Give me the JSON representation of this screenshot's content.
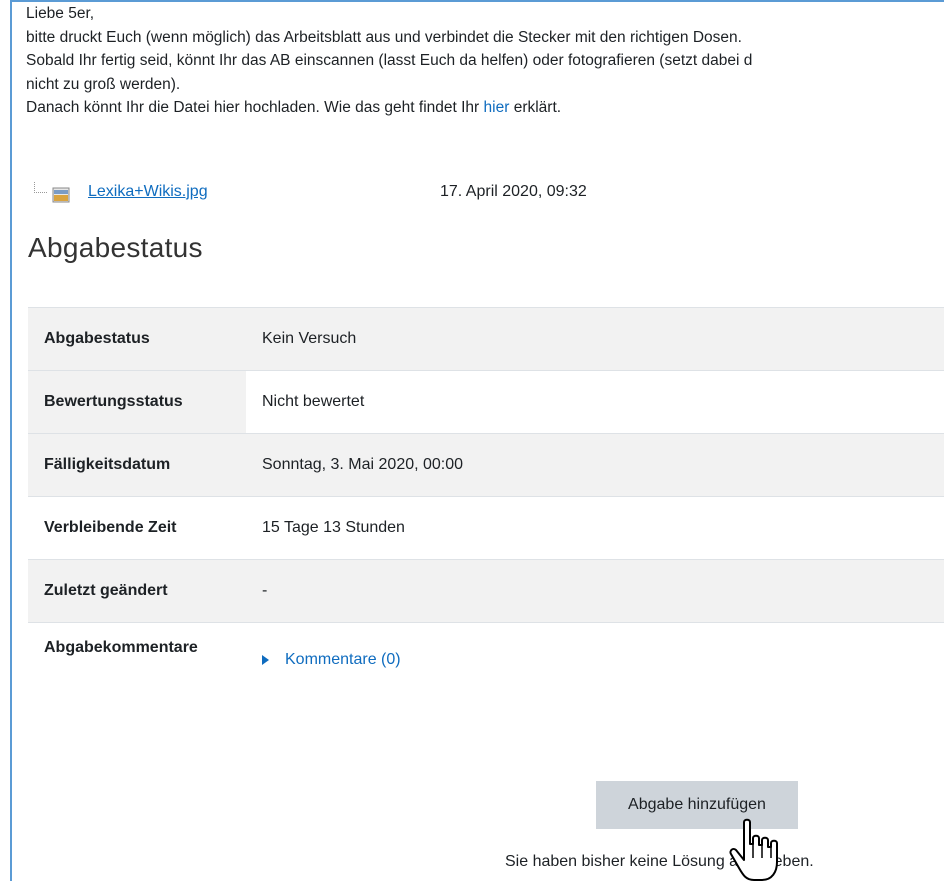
{
  "intro": {
    "line1": "Liebe 5er,",
    "line2": "bitte druckt Euch (wenn möglich) das Arbeitsblatt aus und verbindet die Stecker mit den richtigen Dosen.",
    "line3": "Sobald Ihr fertig seid, könnt Ihr das AB einscannen (lasst Euch da helfen) oder fotografieren (setzt dabei d",
    "line4": "nicht zu groß werden).",
    "line5_before": "Danach könnt Ihr die Datei hier hochladen. Wie das geht findet Ihr ",
    "line5_link": "hier",
    "line5_after": " erklärt."
  },
  "attachment": {
    "icon": "image-file-icon",
    "name": "Lexika+Wikis.jpg",
    "date": "17. April 2020, 09:32"
  },
  "section_title": "Abgabestatus",
  "status_rows": [
    {
      "label": "Abgabestatus",
      "value": "Kein Versuch"
    },
    {
      "label": "Bewertungsstatus",
      "value": "Nicht bewertet"
    },
    {
      "label": "Fälligkeitsdatum",
      "value": "Sonntag, 3. Mai 2020, 00:00"
    },
    {
      "label": "Verbleibende Zeit",
      "value": "15 Tage 13 Stunden"
    },
    {
      "label": "Zuletzt geändert",
      "value": "-"
    },
    {
      "label": "Abgabekommentare",
      "value": "Kommentare (0)"
    }
  ],
  "add_button": "Abgabe hinzufügen",
  "note": "Sie haben bisher keine Lösung abgegeben.",
  "colors": {
    "link": "#0f6cbf",
    "frame": "#5b9bd5",
    "button": "#ced4da"
  }
}
